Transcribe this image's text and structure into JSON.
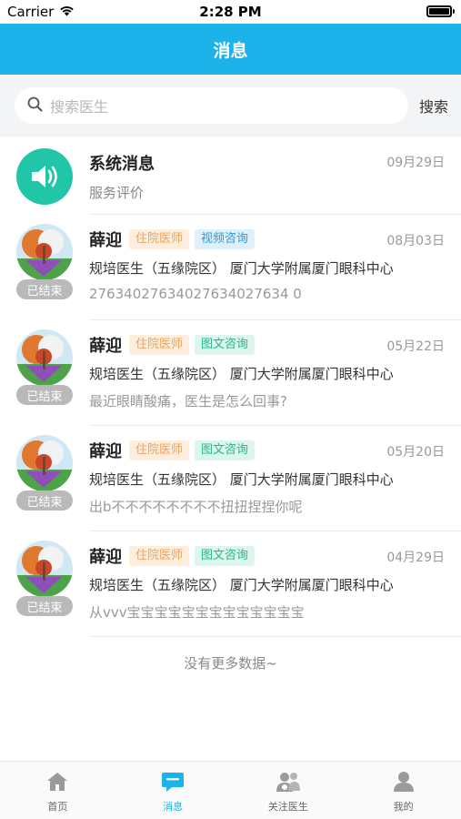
{
  "status_bar": {
    "carrier": "Carrier",
    "time": "2:28 PM"
  },
  "nav": {
    "title": "消息"
  },
  "search": {
    "placeholder": "搜索医生",
    "button_label": "搜索"
  },
  "system_message": {
    "title": "系统消息",
    "subtitle": "服务评价",
    "date": "09月29日"
  },
  "conversations": [
    {
      "name": "薛迎",
      "tag1": "住院医师",
      "tag2": "视频咨询",
      "tag2_type": "blue",
      "date": "08月03日",
      "info": "规培医生（五缘院区） 厦门大学附属厦门眼科中心",
      "message": "27634027634027634027634 0",
      "status": "已结束"
    },
    {
      "name": "薛迎",
      "tag1": "住院医师",
      "tag2": "图文咨询",
      "tag2_type": "teal",
      "date": "05月22日",
      "info": "规培医生（五缘院区） 厦门大学附属厦门眼科中心",
      "message": "最近眼睛酸痛，医生是怎么回事?",
      "status": "已结束"
    },
    {
      "name": "薛迎",
      "tag1": "住院医师",
      "tag2": "图文咨询",
      "tag2_type": "teal",
      "date": "05月20日",
      "info": "规培医生（五缘院区） 厦门大学附属厦门眼科中心",
      "message": "出b不不不不不不不不扭扭捏捏你呢",
      "status": "已结束"
    },
    {
      "name": "薛迎",
      "tag1": "住院医师",
      "tag2": "图文咨询",
      "tag2_type": "teal",
      "date": "04月29日",
      "info": "规培医生（五缘院区） 厦门大学附属厦门眼科中心",
      "message": "从vvv宝宝宝宝宝宝宝宝宝宝宝宝宝",
      "status": "已结束"
    }
  ],
  "footer_text": "没有更多数据~",
  "tabs": [
    {
      "label": "首页",
      "icon": "home-icon",
      "active": false
    },
    {
      "label": "消息",
      "icon": "message-icon",
      "active": true
    },
    {
      "label": "关注医生",
      "icon": "doctors-icon",
      "active": false
    },
    {
      "label": "我的",
      "icon": "profile-icon",
      "active": false
    }
  ],
  "colors": {
    "primary": "#1bb3e9",
    "system_icon_bg": "#21c5a8",
    "tag_orange_text": "#f0a35a",
    "tag_blue_text": "#2f9bd3",
    "tag_teal_text": "#27b58d",
    "ended_badge": "#b9b9b9"
  }
}
